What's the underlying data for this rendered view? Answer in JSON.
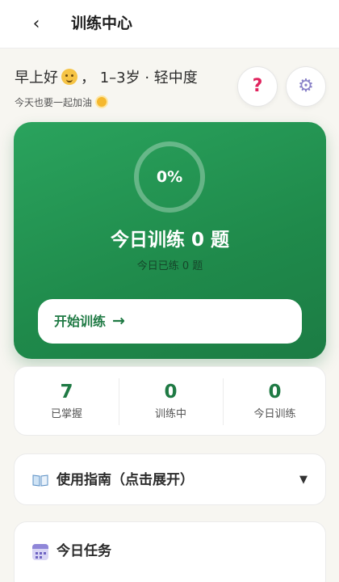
{
  "header": {
    "back_icon": "‹",
    "title": "训练中心"
  },
  "greeting": {
    "hello": "早上好",
    "face_icon": "smiling-face-icon",
    "separator": "，",
    "profile": "1–3岁 · 轻中度",
    "encouragement": "今天也要一起加油",
    "sun_icon": "sun-icon"
  },
  "actions": {
    "help_glyph": "?",
    "settings_glyph": "⚙"
  },
  "hero": {
    "progress_text": "0%",
    "progress_fraction": 0,
    "title": "今日训练 0 题",
    "subtitle": "今日已练 0 题",
    "start_label": "开始训练",
    "start_arrow": "→"
  },
  "stats": [
    {
      "value": "7",
      "label": "已掌握"
    },
    {
      "value": "0",
      "label": "训练中"
    },
    {
      "value": "0",
      "label": "今日训练"
    }
  ],
  "guide": {
    "label": "使用指南（点击展开）",
    "caret": "▼"
  },
  "tasks": {
    "label": "今日任务"
  },
  "colors": {
    "accent_green": "#1f8a4b",
    "help_pink": "#e0245e",
    "settings_purple": "#8a82c8"
  }
}
